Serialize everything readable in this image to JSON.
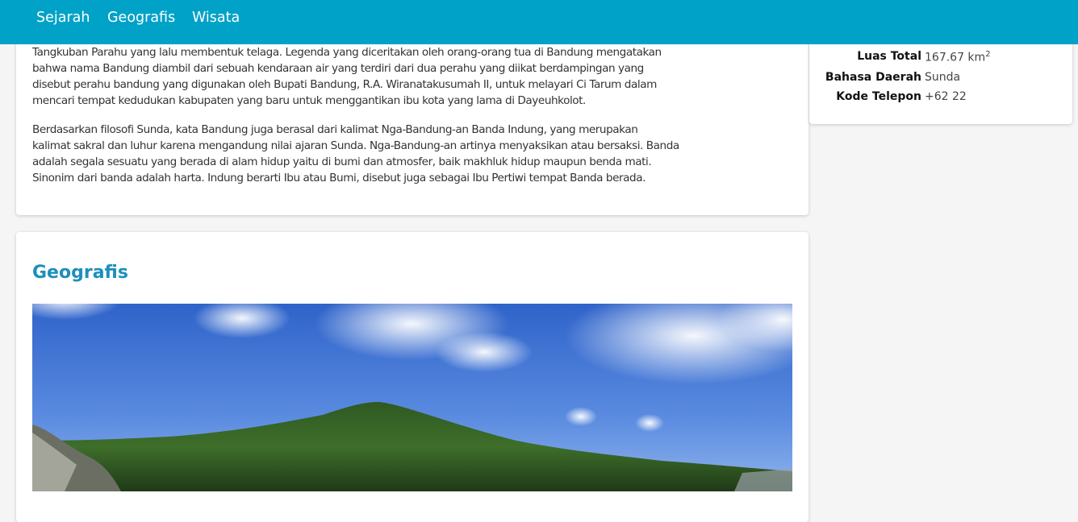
{
  "navbar": {
    "links": [
      "Sejarah",
      "Geografis",
      "Wisata"
    ]
  },
  "sejarah": {
    "paragraphs": [
      "Tangkuban Parahu yang lalu membentuk telaga. Legenda yang diceritakan oleh orang-orang tua di Bandung mengatakan\nbahwa nama Bandung diambil dari sebuah kendaraan air yang terdiri dari dua perahu yang diikat berdampingan yang\ndisebut perahu bandung yang digunakan oleh Bupati Bandung, R.A. Wiranatakusumah II, untuk melayari Ci Tarum dalam\nmencari tempat kedudukan kabupaten yang baru untuk menggantikan ibu kota yang lama di Dayeuhkolot.",
      "Berdasarkan filosofi Sunda, kata Bandung juga berasal dari kalimat Nga-Bandung-an Banda Indung, yang merupakan\nkalimat sakral dan luhur karena mengandung nilai ajaran Sunda. Nga-Bandung-an artinya menyaksikan atau bersaksi. Banda\nadalah segala sesuatu yang berada di alam hidup yaitu di bumi dan atmosfer, baik makhluk hidup maupun benda mati.\nSinonim dari banda adalah harta. Indung berarti Ibu atau Bumi, disebut juga sebagai Ibu Pertiwi tempat Banda berada."
    ]
  },
  "geografis": {
    "title": "Geografis"
  },
  "infobox": {
    "rows": [
      {
        "label": "Luas Total",
        "value": "167.67 km",
        "sup": "2"
      },
      {
        "label": "Bahasa Daerah",
        "value": "Sunda"
      },
      {
        "label": "Kode Telepon",
        "value": "+62 22"
      }
    ]
  },
  "colors": {
    "navbar": "#00a2c7",
    "heading": "#1d8fba"
  }
}
